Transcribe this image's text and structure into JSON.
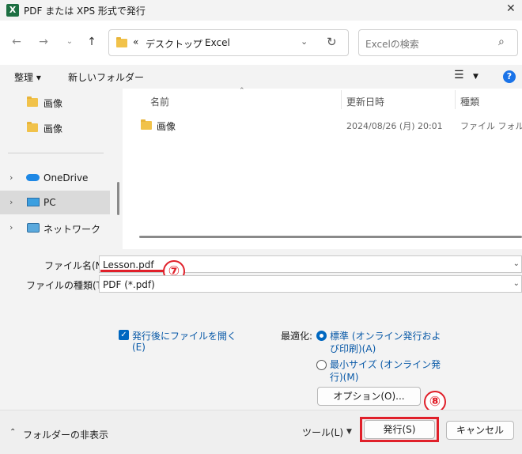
{
  "window": {
    "title": "PDF または XPS 形式で発行",
    "app_icon": "excel-icon"
  },
  "nav": {
    "breadcrumb": [
      "デスクトップ",
      "Excel"
    ],
    "breadcrumb_prefix": "«",
    "search_placeholder": "Excelの検索"
  },
  "toolbar": {
    "organize": "整理 ▾",
    "new_folder": "新しいフォルダー"
  },
  "sidebar": {
    "items": [
      {
        "label": "画像",
        "icon": "folder-icon"
      },
      {
        "label": "画像",
        "icon": "folder-icon"
      },
      {
        "label": "OneDrive",
        "icon": "cloud-icon"
      },
      {
        "label": "PC",
        "icon": "pc-icon"
      },
      {
        "label": "ネットワーク",
        "icon": "network-icon"
      }
    ]
  },
  "file_list": {
    "columns": [
      "名前",
      "更新日時",
      "種類"
    ],
    "rows": [
      {
        "name": "画像",
        "modified": "2024/08/26 (月) 20:01",
        "type": "ファイル フォルダー"
      }
    ]
  },
  "form": {
    "filename_label": "ファイル名(N):",
    "filename_value": "Lesson.pdf",
    "filetype_label": "ファイルの種類(T):",
    "filetype_value": "PDF (*.pdf)",
    "open_after_line1": "発行後にファイルを開く",
    "open_after_line2": "(E)",
    "optimize_label": "最適化:",
    "opt_standard_line1": "標準 (オンライン発行およ",
    "opt_standard_line2": "び印刷)(A)",
    "opt_min_line1": "最小サイズ (オンライン発",
    "opt_min_line2": "行)(M)",
    "options_button": "オプション(O)...",
    "annotation_7": "⑦",
    "annotation_8": "⑧"
  },
  "footer": {
    "hide_folders": "フォルダーの非表示",
    "tools": "ツール(L)",
    "publish": "発行(S)",
    "cancel": "キャンセル"
  },
  "colors": {
    "accent": "#0067c0",
    "annotation": "#e0202a"
  }
}
